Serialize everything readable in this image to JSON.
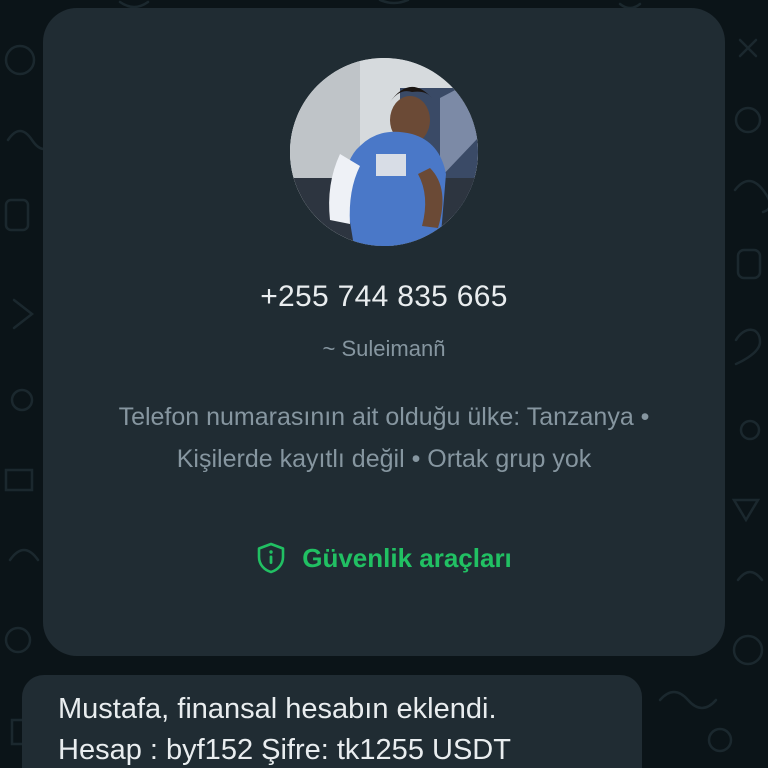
{
  "contact": {
    "phone": "+255 744 835 665",
    "pushname": "~ Suleimanñ",
    "context_text": "Telefon numarasının ait olduğu ülke: Tanzanya • Kişilerde kayıtlı değil • Ortak grup yok",
    "avatar_icon": "profile-photo"
  },
  "safety_tools": {
    "label": "Güvenlik araçları",
    "icon": "shield-icon",
    "color": "#21c063"
  },
  "message": {
    "line1": "Mustafa, finansal hesabın eklendi.",
    "line2": "Hesap : byf152 Şifre: tk1255 USDT"
  },
  "colors": {
    "wallpaper": "#0b1418",
    "card": "#202c33",
    "primary_text": "#e9edef",
    "secondary_text": "#8696a0",
    "accent": "#21c063"
  }
}
